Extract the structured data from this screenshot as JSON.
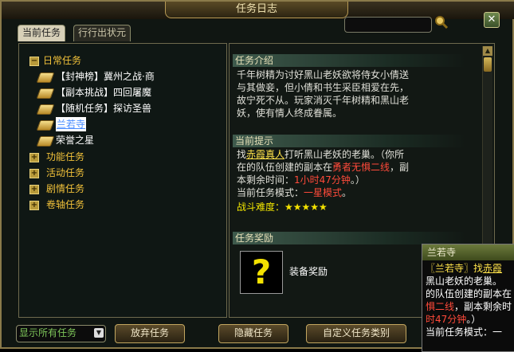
{
  "window": {
    "title": "任务日志",
    "close_symbol": "✕"
  },
  "tabs": [
    {
      "label": "当前任务"
    },
    {
      "label": "行行出状元"
    }
  ],
  "tree": {
    "daily": {
      "label": "日常任务",
      "expander": "−"
    },
    "daily_items": [
      {
        "label": "【封神榜】冀州之战·商"
      },
      {
        "label": "【副本挑战】四回屠魔"
      },
      {
        "label": "【随机任务】探访圣兽"
      },
      {
        "label": "兰若寺"
      },
      {
        "label": "荣誉之星"
      }
    ],
    "categories": [
      {
        "label": "功能任务",
        "expander": "+"
      },
      {
        "label": "活动任务",
        "expander": "+"
      },
      {
        "label": "剧情任务",
        "expander": "+"
      },
      {
        "label": "卷轴任务",
        "expander": "+"
      }
    ]
  },
  "detail": {
    "intro_heading": "任务介绍",
    "intro_lines": [
      "千年树精为讨好黑山老妖欲将侍女小倩送",
      "与其做妾，但小倩和书生采臣相爱在先，",
      "故宁死不从。玩家消灭千年树精和黑山老",
      "妖，使有情人终成眷属。"
    ],
    "hint_heading": "当前提示",
    "hint": {
      "l1_a": "找",
      "l1_npc": "赤霞真人",
      "l1_b": "打听黑山老妖的老巢。（你所",
      "l2_a": "在的队伍创建的副本在",
      "l2_mode": "勇者无惧二线",
      "l2_b": "，副",
      "l3_a": "本剩余时间：",
      "l3_time": "1小时47分钟",
      "l3_b": "。）",
      "l4_a": "当前任务模式：",
      "l4_mode": "一星模式",
      "l4_b": "。"
    },
    "difficulty_label": "战斗难度：",
    "difficulty_stars": "★★★★★",
    "reward_heading": "任务奖励",
    "reward_label": "装备奖励",
    "reward_icon": "?"
  },
  "tooltip": {
    "title": "兰若寺",
    "l1_a": "〖兰若寺〗找",
    "l1_npc": "赤霞",
    "l2": "黑山老妖的老巢。",
    "l3": "的队伍创建的副本在",
    "l4_mode": "惧二线",
    "l4_b": "，副本剩余时",
    "l5_time": "时47分钟",
    "l5_b": "。）",
    "l6": "当前任务模式：一"
  },
  "bottom": {
    "filter": "显示所有任务",
    "abandon": "放弃任务",
    "hide": "隐藏任务",
    "custom": "自定义任务类别"
  },
  "colors": {
    "npc": "#ffe34a",
    "mode": "#ff4a3a",
    "time": "#ff4a3a",
    "selected": "#4a8cff",
    "green": "#7ec65a"
  }
}
